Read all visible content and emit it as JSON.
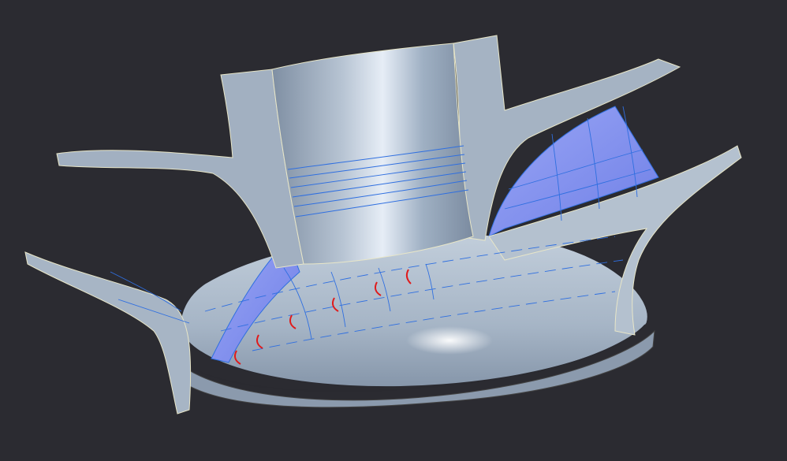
{
  "viewport": {
    "background": "#2b2b31",
    "model": {
      "part": "impeller-with-blades",
      "surface_color": "#aab9c9",
      "edge_color": "#e8e6c8",
      "wire_color": "#2f6fe0",
      "highlight_face_color": "#8a97f0",
      "marker_color": "#e01a1a"
    }
  }
}
